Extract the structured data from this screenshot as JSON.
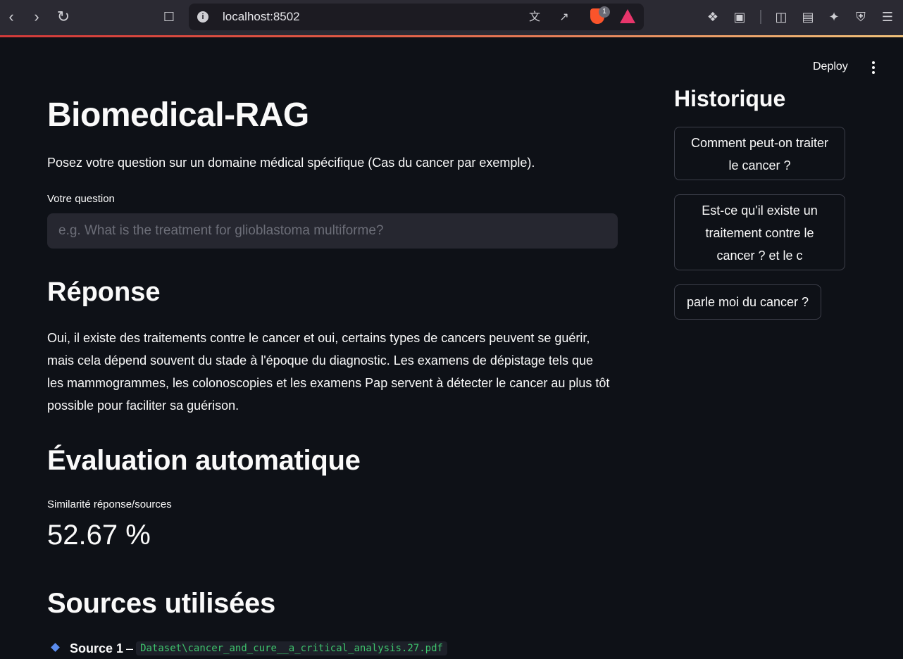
{
  "browser": {
    "url": "localhost:8502",
    "extension_badge": "1"
  },
  "header": {
    "deploy_label": "Deploy"
  },
  "main": {
    "title": "Biomedical-RAG",
    "subtitle": "Posez votre question sur un domaine médical spécifique (Cas du cancer par exemple).",
    "question_label": "Votre question",
    "question_placeholder": "e.g. What is the treatment for glioblastoma multiforme?",
    "question_value": "",
    "response_heading": "Réponse",
    "response_text": "Oui, il existe des traitements contre le cancer et oui, certains types de cancers peuvent se guérir, mais cela dépend souvent du stade à l'époque du diagnostic. Les examens de dépistage tels que les mammogrammes, les colonoscopies et les examens Pap servent à détecter le cancer au plus tôt possible pour faciliter sa guérison.",
    "evaluation_heading": "Évaluation automatique",
    "metric_label": "Similarité réponse/sources",
    "metric_value": "52.67 %",
    "sources_heading": "Sources utilisées",
    "sources": [
      {
        "label": "Source 1",
        "separator": "–",
        "file": "Dataset\\cancer_and_cure__a_critical_analysis.27.pdf"
      }
    ]
  },
  "history": {
    "heading": "Historique",
    "items": [
      {
        "label": "Comment peut-on traiter le cancer ?"
      },
      {
        "label": "Est-ce qu'il existe un traitement contre le cancer ? et le c"
      },
      {
        "label": "parle moi du cancer ?"
      }
    ]
  },
  "colors": {
    "background": "#0e1117",
    "input_bg": "#262730",
    "code_green": "#3ec46d",
    "bullet_blue": "#5b8def"
  }
}
